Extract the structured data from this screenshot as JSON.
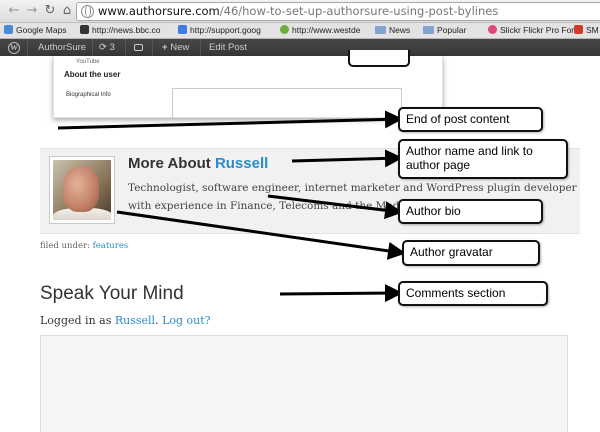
{
  "browser": {
    "url_host": "www.authorsure.com",
    "url_path": "/46/how-to-set-up-authorsure-using-post-bylines",
    "back_icon": "left-arrow-icon",
    "forward_icon": "right-arrow-icon",
    "reload_icon": "reload-icon",
    "home_icon": "home-icon",
    "bookmarks": [
      {
        "label": "Google Maps",
        "icon": "google-maps-icon",
        "color": "#4a8bd6"
      },
      {
        "label": "http://news.bbc.co",
        "icon": "bbc-icon",
        "color": "#333333"
      },
      {
        "label": "http://support.goog",
        "icon": "google-icon",
        "color": "#3b7de0"
      },
      {
        "label": "http://www.westde",
        "icon": "leaf-icon",
        "color": "#6fae3a"
      },
      {
        "label": "News",
        "icon": "folder-icon",
        "color": "#7fa4cf"
      },
      {
        "label": "Popular",
        "icon": "folder-icon",
        "color": "#7fa4cf"
      },
      {
        "label": "Slickr Flickr Pro Foru",
        "icon": "flickr-icon",
        "color": "#e0457b"
      },
      {
        "label": "SM",
        "icon": "sm-icon",
        "color": "#d23b2b"
      }
    ]
  },
  "adminbar": {
    "site_name": "AuthorSure",
    "updates_count": "3",
    "new_label": "New",
    "edit_label": "Edit Post"
  },
  "embedded": {
    "youtube": "YouTube",
    "heading": "About the user",
    "bio_label": "Biographical Info"
  },
  "author": {
    "heading_prefix": "More About ",
    "name": "Russell",
    "bio": "Technologist, software engineer, internet marketer and WordPress plugin developer with experience in Finance, Telecoms and the Media."
  },
  "filed": {
    "prefix": "filed under: ",
    "category": "features"
  },
  "comments": {
    "heading": "Speak Your Mind",
    "logged_prefix": "Logged in as ",
    "user": "Russell",
    "logout": "Log out?"
  },
  "annotations": {
    "end_post": "End of post content",
    "author_link": "Author name and link to author page",
    "author_bio": "Author bio",
    "author_gravatar": "Author gravatar",
    "comments_section": "Comments section"
  }
}
